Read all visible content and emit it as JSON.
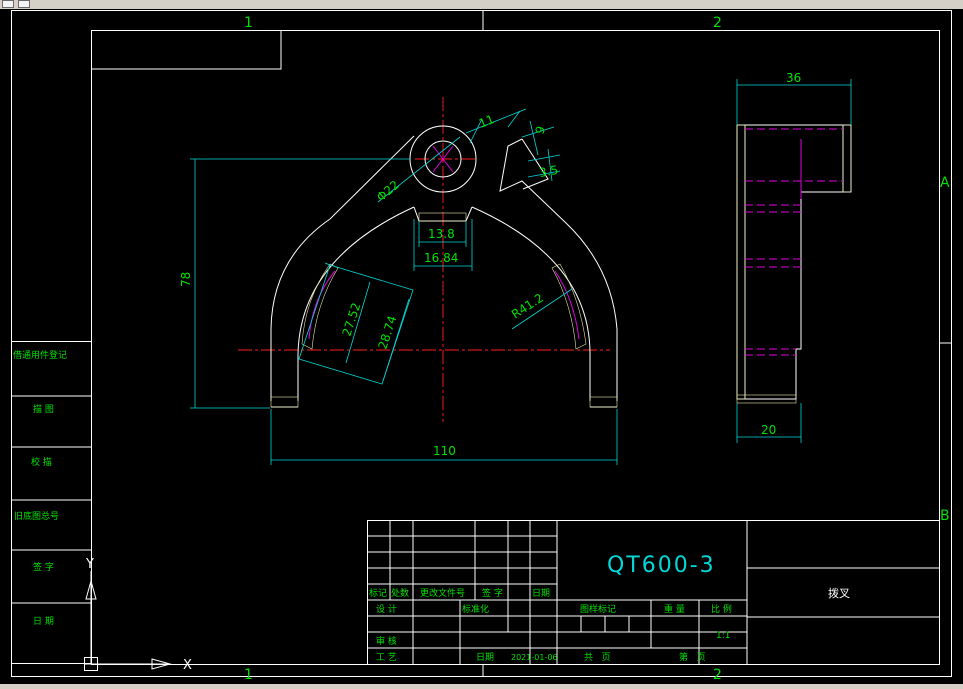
{
  "zones": {
    "col1": "1",
    "col2": "2",
    "rowA": "A",
    "rowB": "B"
  },
  "left_panel": {
    "row1": "借通用件登记",
    "row2": "描 图",
    "row3": "校 描",
    "row4": "旧底图总号",
    "row5": "签 字",
    "row6": "日 期"
  },
  "dimensions": {
    "d_11": "11",
    "d_9": "9",
    "d_3_5": "3.5",
    "d_phi22": "Φ22",
    "d_13_8": "13.8",
    "d_16_84": "16.84",
    "d_78": "78",
    "d_27_52": "27.52",
    "d_28_74": "28.74",
    "d_r41_2": "R41.2",
    "d_110": "110",
    "d_36": "36",
    "d_20": "20"
  },
  "title_block": {
    "material": "QT600-3",
    "part_name": "拨叉",
    "h_mark": "标记",
    "h_count": "处数",
    "h_docno": "更改文件号",
    "h_sign": "签 字",
    "h_date": "日期",
    "r_design": "设 计",
    "r_standard": "标准化",
    "r_review": "审 核",
    "r_process": "工 艺",
    "r_date_label": "日期",
    "r_date_value": "2021-01-06",
    "h_stage": "图样标记",
    "h_weight": "重 量",
    "h_scale": "比 例",
    "scale_value": "1:1",
    "sheets_total": "共   页",
    "sheet_no": "第   页"
  },
  "ucs": {
    "x_label": "X",
    "y_label": "Y"
  },
  "colors": {
    "background": "#000000",
    "frame": "#ffffff",
    "dimension": "#00d8d8",
    "text": "#00e000",
    "centerline": "#ff2020",
    "hidden": "#e000e0"
  }
}
